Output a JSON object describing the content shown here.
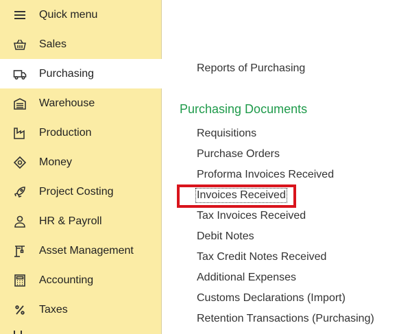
{
  "sidebar": {
    "items": [
      {
        "label": "Quick menu",
        "icon": "hamburger-menu-icon"
      },
      {
        "label": "Sales",
        "icon": "basket-icon"
      },
      {
        "label": "Purchasing",
        "icon": "truck-icon",
        "active": true
      },
      {
        "label": "Warehouse",
        "icon": "warehouse-icon"
      },
      {
        "label": "Production",
        "icon": "factory-icon"
      },
      {
        "label": "Money",
        "icon": "money-tag-icon"
      },
      {
        "label": "Project Costing",
        "icon": "rocket-icon"
      },
      {
        "label": "HR & Payroll",
        "icon": "person-icon"
      },
      {
        "label": "Asset Management",
        "icon": "crane-icon"
      },
      {
        "label": "Accounting",
        "icon": "calculator-icon"
      },
      {
        "label": "Taxes",
        "icon": "percent-icon"
      }
    ]
  },
  "main": {
    "reports_link": "Reports of Purchasing",
    "section_title": "Purchasing Documents",
    "documents": [
      "Requisitions",
      "Purchase Orders",
      "Proforma Invoices Received",
      "Invoices Received",
      "Tax Invoices Received",
      "Debit Notes",
      "Tax Credit Notes Received",
      "Additional Expenses",
      "Customs Declarations (Import)",
      "Retention Transactions (Purchasing)"
    ]
  },
  "colors": {
    "sidebar_bg": "#fbeca5",
    "section_title": "#1e9a4a",
    "highlight": "#d9141c"
  }
}
